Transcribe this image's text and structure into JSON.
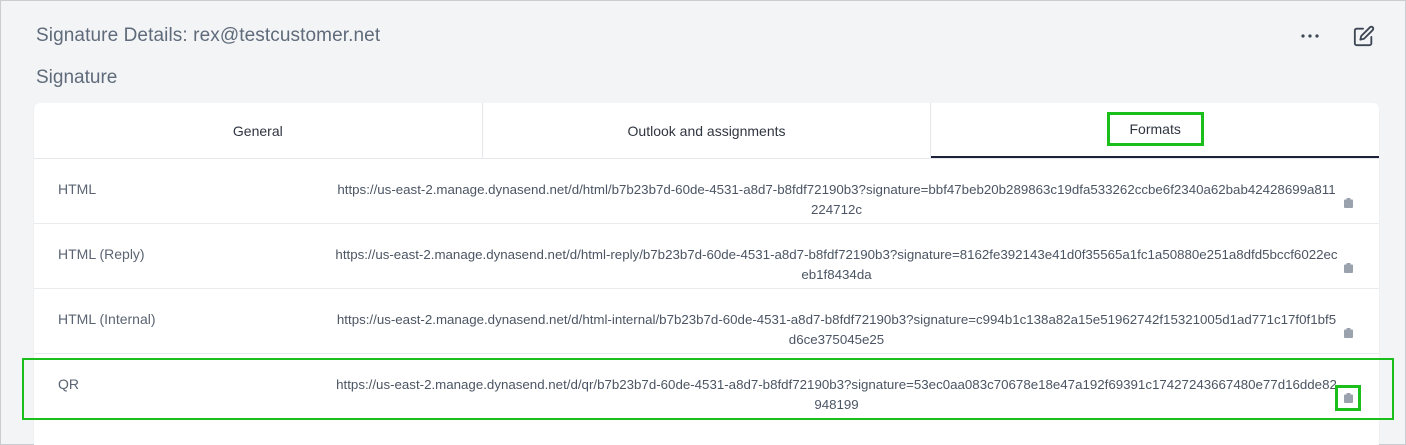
{
  "header": {
    "title": "Signature Details: rex@testcustomer.net",
    "more_icon": "more-horizontal-icon",
    "edit_icon": "edit-icon"
  },
  "section": {
    "title": "Signature"
  },
  "tabs": [
    {
      "label": "General",
      "active": false
    },
    {
      "label": "Outlook and assignments",
      "active": false
    },
    {
      "label": "Formats",
      "active": true
    }
  ],
  "formats": [
    {
      "label": "HTML",
      "url": "https://us-east-2.manage.dynasend.net/d/html/b7b23b7d-60de-4531-a8d7-b8fdf72190b3?signature=bbf47beb20b289863c19dfa533262ccbe6f2340a62bab42428699a811224712c"
    },
    {
      "label": "HTML (Reply)",
      "url": "https://us-east-2.manage.dynasend.net/d/html-reply/b7b23b7d-60de-4531-a8d7-b8fdf72190b3?signature=8162fe392143e41d0f35565a1fc1a50880e251a8dfd5bccf6022eceb1f8434da"
    },
    {
      "label": "HTML (Internal)",
      "url": "https://us-east-2.manage.dynasend.net/d/html-internal/b7b23b7d-60de-4531-a8d7-b8fdf72190b3?signature=c994b1c138a82a15e51962742f15321005d1ad771c17f0f1bf5d6ce375045e25"
    },
    {
      "label": "QR",
      "url": "https://us-east-2.manage.dynasend.net/d/qr/b7b23b7d-60de-4531-a8d7-b8fdf72190b3?signature=53ec0aa083c70678e18e47a192f69391c17427243667480e77d16dde82948199"
    }
  ],
  "colors": {
    "highlight": "#1bbf1b",
    "active_tab_underline": "#1e2238"
  }
}
